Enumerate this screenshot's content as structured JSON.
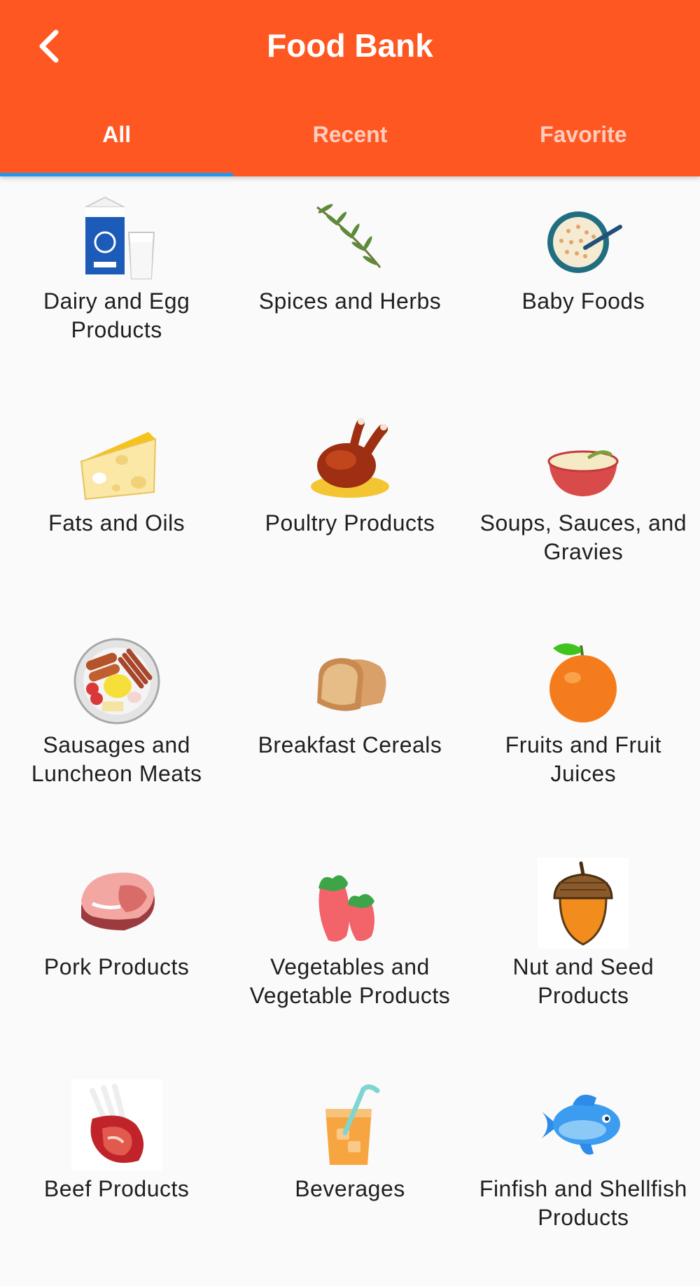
{
  "app_bar": {
    "title": "Food Bank",
    "back_icon": "chevron-left-icon"
  },
  "tabs": [
    {
      "label": "All",
      "active": true
    },
    {
      "label": "Recent",
      "active": false
    },
    {
      "label": "Favorite",
      "active": false
    }
  ],
  "colors": {
    "app_bar": "#ff5722",
    "tab_indicator": "#2196f3",
    "background": "#fafafa"
  },
  "categories": [
    {
      "label": "Dairy and Egg Products",
      "icon": "milk-carton-icon"
    },
    {
      "label": "Spices and Herbs",
      "icon": "herb-sprig-icon"
    },
    {
      "label": "Baby Foods",
      "icon": "cereal-bowl-icon"
    },
    {
      "label": "Fats and Oils",
      "icon": "cheese-icon"
    },
    {
      "label": "Poultry Products",
      "icon": "roast-chicken-icon"
    },
    {
      "label": "Soups, Sauces, and Gravies",
      "icon": "soup-bowl-icon"
    },
    {
      "label": "Sausages and Luncheon Meats",
      "icon": "breakfast-plate-icon"
    },
    {
      "label": "Breakfast Cereals",
      "icon": "bread-slices-icon"
    },
    {
      "label": "Fruits and Fruit Juices",
      "icon": "orange-icon"
    },
    {
      "label": "Pork Products",
      "icon": "pork-chop-icon"
    },
    {
      "label": "Vegetables and Vegetable Products",
      "icon": "carrots-icon"
    },
    {
      "label": "Nut and Seed Products",
      "icon": "acorn-icon"
    },
    {
      "label": "Beef Products",
      "icon": "beef-ribs-icon"
    },
    {
      "label": "Beverages",
      "icon": "juice-glass-icon"
    },
    {
      "label": "Finfish and Shellfish Products",
      "icon": "fish-icon"
    }
  ]
}
